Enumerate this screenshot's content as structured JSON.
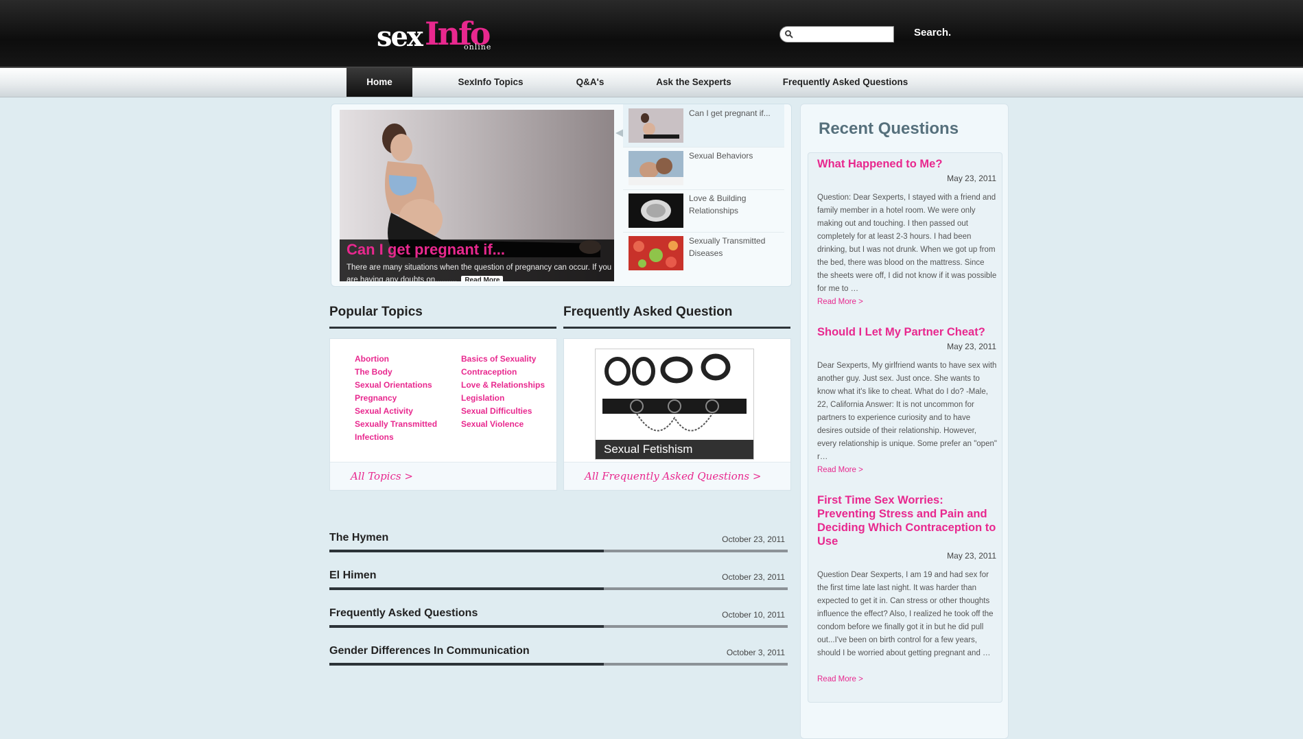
{
  "header": {
    "logo_sex": "sex",
    "logo_info": "Info",
    "logo_online": "online",
    "search_placeholder": "",
    "search_button": "Search."
  },
  "nav": {
    "items": [
      {
        "label": "Home",
        "active": true
      },
      {
        "label": "SexInfo Topics"
      },
      {
        "label": "Q&A's"
      },
      {
        "label": "Ask the Sexperts"
      },
      {
        "label": "Frequently Asked Questions"
      }
    ]
  },
  "slider": {
    "caption_title": "Can I get pregnant if...",
    "caption_text": "There are many situations when the question of pregnancy can occur. If you are having any doubts on..........",
    "read_more": "Read More",
    "thumbs": [
      {
        "label": "Can I get pregnant if..."
      },
      {
        "label": "Sexual Behaviors"
      },
      {
        "label": "Love & Building Relationships"
      },
      {
        "label": "Sexually Transmitted Diseases"
      }
    ]
  },
  "popular_topics": {
    "heading": "Popular Topics",
    "col1": [
      "Abortion",
      "The Body",
      "Sexual Orientations",
      "Pregnancy",
      "Sexual Activity",
      "Sexually Transmitted Infections"
    ],
    "col2": [
      "Basics of Sexuality",
      "Contraception",
      "Love & Relationships",
      "Legislation",
      "Sexual Difficulties",
      "Sexual Violence"
    ],
    "footer_link": "All Topics >"
  },
  "faq": {
    "heading": "Frequently Asked Question",
    "image_caption": "Sexual Fetishism",
    "footer_link": "All Frequently Asked Questions >"
  },
  "articles": [
    {
      "title": "The Hymen",
      "date": "October 23, 2011"
    },
    {
      "title": "El Himen",
      "date": "October 23, 2011"
    },
    {
      "title": "Frequently Asked Questions",
      "date": "October 10, 2011"
    },
    {
      "title": "Gender Differences In Communication",
      "date": "October 3, 2011"
    }
  ],
  "recent_questions": {
    "heading": "Recent Questions",
    "items": [
      {
        "title": "What Happened to Me?",
        "date": "May 23, 2011",
        "body": "Question: Dear Sexperts, I stayed with a friend and family member in a hotel room. We were only making out and touching. I then passed out completely for at least 2-3 hours. I had been drinking, but I was not drunk. When we got up from the bed, there was blood on the mattress. Since the sheets were off, I did not know if it was possible for me to …",
        "read_more": "Read More >"
      },
      {
        "title": "Should I Let My Partner Cheat?",
        "date": "May 23, 2011",
        "body": "Dear Sexperts, My girlfriend wants to have sex with another guy. Just sex. Just once. She wants to know what it's like to cheat. What do I do? -Male, 22, California Answer: It is not uncommon for partners to experience curiosity and to have desires outside of their relationship. However, every relationship is unique. Some prefer an \"open\" r…",
        "read_more": "Read More >"
      },
      {
        "title": "First Time Sex Worries: Preventing Stress and Pain and Deciding Which Contraception to Use",
        "date": "May 23, 2011",
        "body": "Question Dear Sexperts, I am 19 and had sex for the first time late last night. It was harder than expected to get it in. Can stress or other thoughts influence the effect? Also, I realized he took off the condom before we finally got it in but he did pull out...I've been on birth control for a few years, should I be worried about getting pregnant and …",
        "read_more": "Read More >"
      }
    ]
  }
}
